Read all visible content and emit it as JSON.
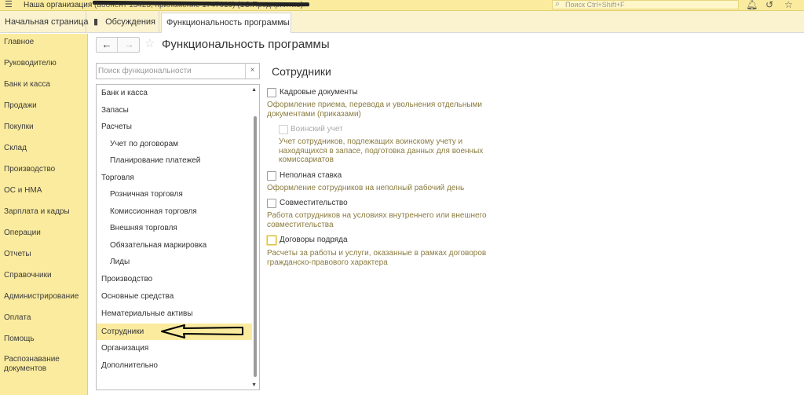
{
  "topbar": {
    "menu_icon": "hamburger-icon",
    "org_name": "Наша организация",
    "org_sub": "(абонент 13423, приложение 1747010)  (1С:Предприятие)",
    "search_placeholder": "Поиск Ctrl+Shift+F",
    "icons": [
      "bell-icon",
      "history-icon",
      "star-icon"
    ]
  },
  "tabs": [
    {
      "label": "Начальная страница"
    },
    {
      "label": "Обсуждения"
    },
    {
      "label": "Функциональность программы",
      "active": true,
      "close": "×"
    }
  ],
  "sidebar": {
    "items": [
      {
        "label": "Главное"
      },
      {
        "label": "Руководителю"
      },
      {
        "label": "Банк и касса"
      },
      {
        "label": "Продажи"
      },
      {
        "label": "Покупки"
      },
      {
        "label": "Склад"
      },
      {
        "label": "Производство"
      },
      {
        "label": "ОС и НМА"
      },
      {
        "label": "Зарплата и кадры"
      },
      {
        "label": "Операции"
      },
      {
        "label": "Отчеты"
      },
      {
        "label": "Справочники"
      },
      {
        "label": "Администрирование"
      },
      {
        "label": "Оплата"
      },
      {
        "label": "Помощь"
      },
      {
        "label": "Распознавание"
      },
      {
        "label": "документов"
      }
    ]
  },
  "header": {
    "back": "←",
    "forward": "→",
    "star": "☆",
    "title": "Функциональность программы"
  },
  "search": {
    "placeholder": "Поиск функциональности",
    "clear": "×"
  },
  "tree": {
    "items": [
      {
        "label": "Банк и касса",
        "level": 1
      },
      {
        "label": "Запасы",
        "level": 1
      },
      {
        "label": "Расчеты",
        "level": 1
      },
      {
        "label": "Учет по договорам",
        "level": 2
      },
      {
        "label": "Планирование платежей",
        "level": 2
      },
      {
        "label": "Торговля",
        "level": 1
      },
      {
        "label": "Розничная торговля",
        "level": 2
      },
      {
        "label": "Комиссионная торговля",
        "level": 2
      },
      {
        "label": "Внешняя торговля",
        "level": 2
      },
      {
        "label": "Обязательная маркировка",
        "level": 2
      },
      {
        "label": "Лиды",
        "level": 2
      },
      {
        "label": "Производство",
        "level": 1
      },
      {
        "label": "Основные средства",
        "level": 1
      },
      {
        "label": "Нематериальные активы",
        "level": 1
      },
      {
        "label": "Сотрудники",
        "level": 1,
        "selected": true
      },
      {
        "label": "Организация",
        "level": 1
      },
      {
        "label": "Дополнительно",
        "level": 1
      }
    ]
  },
  "section": {
    "title": "Сотрудники",
    "options": [
      {
        "label": "Кадровые документы",
        "checked": false,
        "desc": "Оформление приема, перевода и увольнения отдельными документами (приказами)"
      },
      {
        "label": "Воинский учет",
        "checked": false,
        "disabled": true,
        "desc": "Учет сотрудников, подлежащих воинскому учету и находящихся в запасе, подготовка данных для военных комиссариатов"
      },
      {
        "label": "Неполная ставка",
        "checked": false,
        "desc": "Оформление сотрудников на неполный рабочий день"
      },
      {
        "label": "Совместительство",
        "checked": false,
        "desc": "Работа сотрудников на условиях внутреннего или внешнего совместительства"
      },
      {
        "label": "Договоры подряда",
        "checked": false,
        "focused": true,
        "desc": "Расчеты за работы и услуги, оказанные в рамках договоров гражданско-правового характера"
      }
    ]
  },
  "colors": {
    "sidebar_bg": "#fbeb9e",
    "selected_bg": "#fbeb9e",
    "desc_text": "#8a7b3f"
  }
}
